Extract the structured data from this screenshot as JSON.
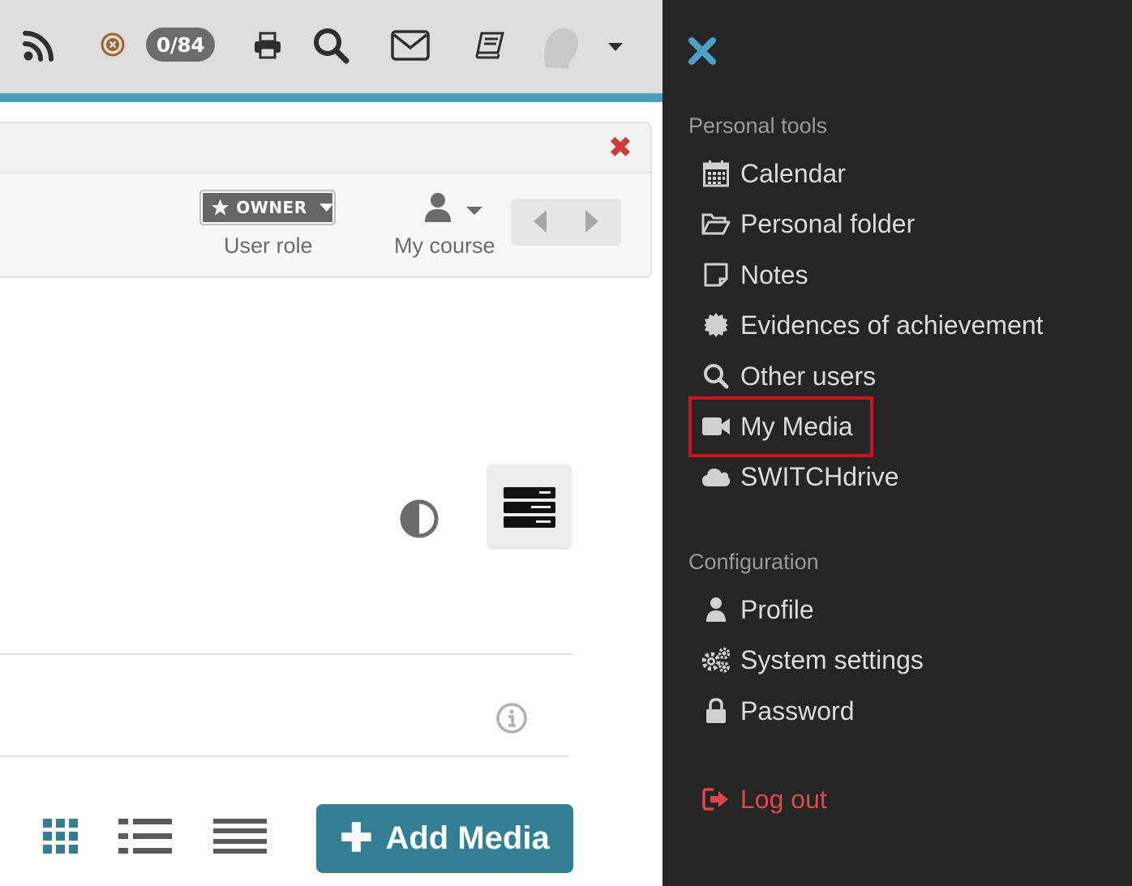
{
  "topbar": {
    "counter": "0/84",
    "icons": [
      "rss-icon",
      "status-x-icon",
      "print-icon",
      "search-icon",
      "mail-icon",
      "book-icon",
      "avatar",
      "chevron-down-icon"
    ]
  },
  "panel": {
    "role_button_label": "OWNER",
    "role_caption": "User role",
    "course_caption": "My course"
  },
  "toolbar": {
    "add_media_label": "Add Media"
  },
  "drawer": {
    "personal_tools_heading": "Personal tools",
    "personal_items": [
      {
        "label": "Calendar",
        "icon": "calendar-icon"
      },
      {
        "label": "Personal folder",
        "icon": "folder-icon"
      },
      {
        "label": "Notes",
        "icon": "note-icon"
      },
      {
        "label": "Evidences of achievement",
        "icon": "badge-icon"
      },
      {
        "label": "Other users",
        "icon": "search-icon"
      },
      {
        "label": "My Media",
        "icon": "video-camera-icon"
      },
      {
        "label": "SWITCHdrive",
        "icon": "cloud-icon"
      }
    ],
    "configuration_heading": "Configuration",
    "config_items": [
      {
        "label": "Profile",
        "icon": "user-icon"
      },
      {
        "label": "System settings",
        "icon": "gears-icon"
      },
      {
        "label": "Password",
        "icon": "lock-icon"
      }
    ],
    "logout_label": "Log out"
  },
  "colors": {
    "accent": "#4ea0b8",
    "drawer_bg": "#252525",
    "add_media_bg": "#327f94",
    "highlight": "#d0141d",
    "logout": "#e0474c",
    "close_drawer": "#4aa3c7"
  }
}
